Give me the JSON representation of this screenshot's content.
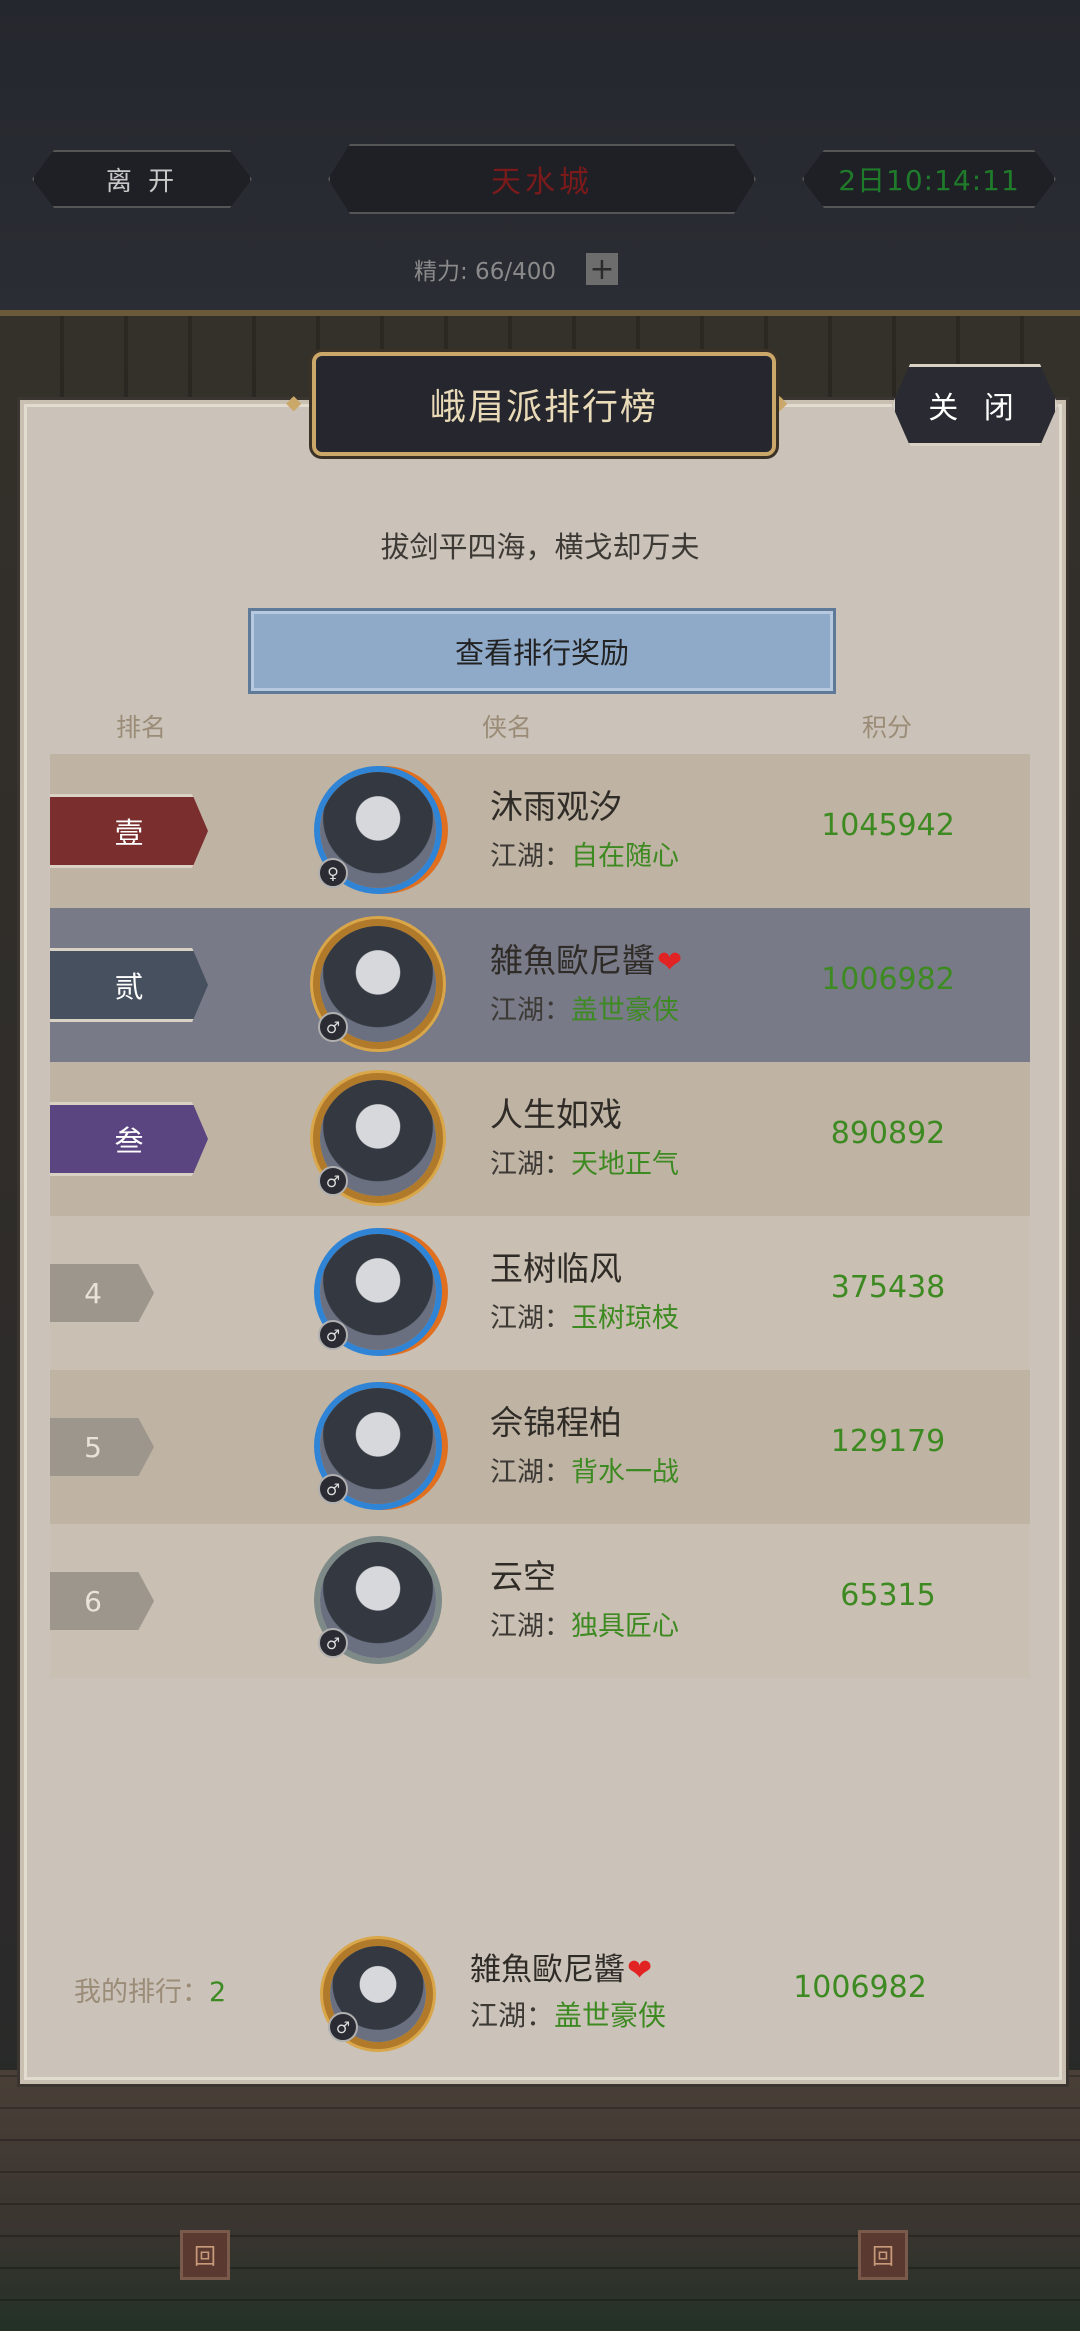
{
  "hud": {
    "leave_label": "离 开",
    "city_label": "天水城",
    "time_label": "2日10:14:11",
    "energy_label": "精力: 66/400",
    "plus_label": "+"
  },
  "panel": {
    "title": "峨眉派排行榜",
    "close_label": "关 闭",
    "motto": "拔剑平四海，横戈却万夫",
    "reward_button": "查看排行奖励",
    "columns": {
      "rank": "排名",
      "name": "侠名",
      "score": "积分"
    }
  },
  "rows": [
    {
      "rank": "壹",
      "name": "沐雨观汐",
      "title_prefix": "江湖：",
      "title": "自在随心",
      "score": "1045942",
      "gender": "♀"
    },
    {
      "rank": "贰",
      "name": "雑魚歐尼醬",
      "title_prefix": "江湖：",
      "title": "盖世豪侠",
      "score": "1006982",
      "gender": "♂",
      "heart": "❤"
    },
    {
      "rank": "叁",
      "name": "人生如戏",
      "title_prefix": "江湖：",
      "title": "天地正气",
      "score": "890892",
      "gender": "♂"
    },
    {
      "rank": "4",
      "name": "玉树临风",
      "title_prefix": "江湖：",
      "title": "玉树琼枝",
      "score": "375438",
      "gender": "♂"
    },
    {
      "rank": "5",
      "name": "佘锦程柏",
      "title_prefix": "江湖：",
      "title": "背水一战",
      "score": "129179",
      "gender": "♂"
    },
    {
      "rank": "6",
      "name": "云空",
      "title_prefix": "江湖：",
      "title": "独具匠心",
      "score": "65315",
      "gender": "♂"
    }
  ],
  "my_rank": {
    "label": "我的排行：",
    "value": "2",
    "name": "雑魚歐尼醬",
    "heart": "❤",
    "title_prefix": "江湖：",
    "title": "盖世豪侠",
    "score": "1006982",
    "gender": "♂"
  },
  "colors": {
    "panel_bg": "#cbc3b9",
    "selected_row": "#787a88",
    "score_green": "#3e8a22",
    "rank1": "#7a2f2e",
    "rank2": "#46505e",
    "rank3": "#5a4580"
  }
}
